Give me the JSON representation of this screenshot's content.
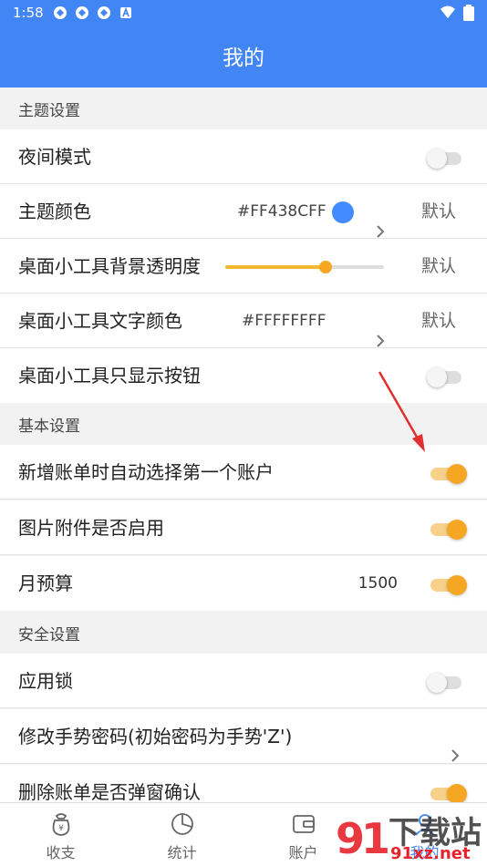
{
  "status_bar": {
    "time": "1:58"
  },
  "header": {
    "title": "我的"
  },
  "sections": {
    "theme": "主题设置",
    "basic": "基本设置",
    "security": "安全设置"
  },
  "rows": {
    "night_mode": {
      "label": "夜间模式",
      "on": false
    },
    "theme_color": {
      "label": "主题颜色",
      "hex": "#FF438CFF",
      "color": "#438CFF",
      "default": "默认"
    },
    "widget_opacity": {
      "label": "桌面小工具背景透明度",
      "value": 0.63,
      "default": "默认"
    },
    "widget_text_color": {
      "label": "桌面小工具文字颜色",
      "hex": "#FFFFFFFF",
      "default": "默认"
    },
    "widget_buttons_only": {
      "label": "桌面小工具只显示按钮",
      "on": false
    },
    "auto_select_account": {
      "label": "新增账单时自动选择第一个账户",
      "on": true
    },
    "image_attachment": {
      "label": "图片附件是否启用",
      "on": true
    },
    "monthly_budget": {
      "label": "月预算",
      "value": "1500",
      "on": true
    },
    "app_lock": {
      "label": "应用锁",
      "on": false
    },
    "change_gesture": {
      "label": "修改手势密码(初始密码为手势'Z')"
    },
    "delete_confirm": {
      "label": "删除账单是否弹窗确认",
      "on": true
    }
  },
  "tabs": [
    {
      "label": "收支",
      "icon": "wallet-bag-icon"
    },
    {
      "label": "统计",
      "icon": "pie-chart-icon"
    },
    {
      "label": "账户",
      "icon": "account-card-icon"
    },
    {
      "label": "我的",
      "icon": "user-icon"
    }
  ],
  "watermark": {
    "text": "下载站",
    "url": "91xz.net"
  },
  "colors": {
    "primary": "#4285F4",
    "accent": "#F5A623"
  }
}
